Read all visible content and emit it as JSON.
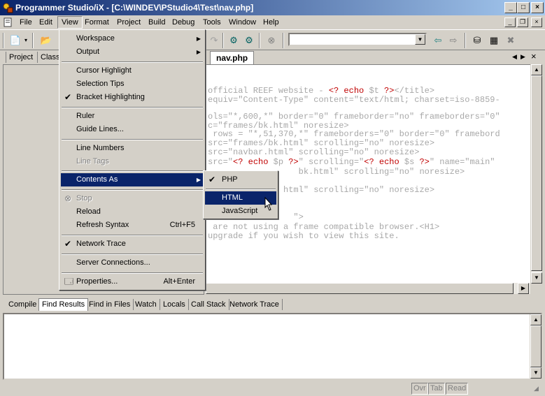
{
  "window": {
    "title": "Programmer Studio/iX - [C:\\WINDEV\\PStudio4\\Test\\nav.php]",
    "minimize_icon": "minimize-icon",
    "maximize_icon": "maximize-icon",
    "close_icon": "close-icon"
  },
  "menubar": {
    "items": [
      "File",
      "Edit",
      "View",
      "Format",
      "Project",
      "Build",
      "Debug",
      "Tools",
      "Window",
      "Help"
    ]
  },
  "panel_tabs": [
    "Project",
    "Class"
  ],
  "document_tab": "nav.php",
  "view_menu": {
    "items": [
      {
        "label": "Workspace",
        "submenu": true
      },
      {
        "label": "Output",
        "submenu": true
      },
      {
        "label": "Cursor Highlight"
      },
      {
        "label": "Selection Tips"
      },
      {
        "label": "Bracket Highlighting",
        "checked": true
      },
      {
        "label": "Ruler"
      },
      {
        "label": "Guide Lines..."
      },
      {
        "label": "Line Numbers"
      },
      {
        "label": "Line Tags",
        "disabled": true
      },
      {
        "label": "Contents As",
        "submenu": true,
        "selected": true
      },
      {
        "label": "Stop",
        "disabled": true
      },
      {
        "label": "Reload"
      },
      {
        "label": "Refresh Syntax",
        "accelerator": "Ctrl+F5"
      },
      {
        "label": "Network Trace",
        "checked": true
      },
      {
        "label": "Server Connections..."
      },
      {
        "label": "Properties...",
        "accelerator": "Alt+Enter"
      }
    ]
  },
  "contents_as_submenu": {
    "items": [
      {
        "label": "PHP",
        "checked": true
      },
      {
        "label": "HTML",
        "selected": true
      },
      {
        "label": "JavaScript"
      }
    ]
  },
  "code_lines": [
    {
      "parts": [
        [
          "t",
          "official REEF website - "
        ],
        [
          "k",
          "<? echo "
        ],
        [
          "t",
          "$t "
        ],
        [
          "k",
          "?>"
        ],
        [
          "t",
          "</title>"
        ]
      ]
    },
    {
      "parts": [
        [
          "t",
          "equiv=\"Content-Type\" content=\"text/html; charset=iso-8859-"
        ]
      ]
    },
    {
      "parts": [
        [
          "t",
          ""
        ]
      ]
    },
    {
      "parts": [
        [
          "t",
          "ols=\"*,600,*\" border=\"0\" frameborder=\"no\" frameborders=\"0\""
        ]
      ]
    },
    {
      "parts": [
        [
          "t",
          "c=\"frames/bk.html\" noresize>"
        ]
      ]
    },
    {
      "parts": [
        [
          "t",
          " rows = \"*,51,370,*\" frameborders=\"0\" border=\"0\" framebord"
        ]
      ]
    },
    {
      "parts": [
        [
          "t",
          "src=\"frames/bk.html\" scrolling=\"no\" noresize>"
        ]
      ]
    },
    {
      "parts": [
        [
          "t",
          "src=\"navbar.html\" scrolling=\"no\" noresize>"
        ]
      ]
    },
    {
      "parts": [
        [
          "t",
          "src=\""
        ],
        [
          "k",
          "<? echo "
        ],
        [
          "t",
          "$p "
        ],
        [
          "k",
          "?>"
        ],
        [
          "t",
          "\" scrolling=\""
        ],
        [
          "k",
          "<? echo "
        ],
        [
          "t",
          "$s "
        ],
        [
          "k",
          "?>"
        ],
        [
          "t",
          "\" name=\"main\""
        ]
      ]
    },
    {
      "parts": [
        [
          "t",
          "                  bk.html\" scrolling=\"no\" noresize>"
        ]
      ]
    },
    {
      "parts": [
        [
          "t",
          ""
        ]
      ]
    },
    {
      "parts": [
        [
          "t",
          "               html\" scrolling=\"no\" noresize>"
        ]
      ]
    },
    {
      "parts": [
        [
          "t",
          ""
        ]
      ]
    },
    {
      "parts": [
        [
          "t",
          ""
        ]
      ]
    },
    {
      "parts": [
        [
          "t",
          "                 \">"
        ]
      ]
    },
    {
      "parts": [
        [
          "t",
          " are not using a frame compatible browser.<H1>"
        ]
      ]
    },
    {
      "parts": [
        [
          "t",
          "upgrade if you wish to view this site."
        ]
      ]
    }
  ],
  "bottom_tabs": [
    "Compile",
    "Find Results",
    "Find in Files",
    "Watch",
    "Locals",
    "Call Stack",
    "Network Trace"
  ],
  "bottom_active_tab": "Find Results",
  "status": [
    "Ovr",
    "Tab",
    "Read"
  ]
}
